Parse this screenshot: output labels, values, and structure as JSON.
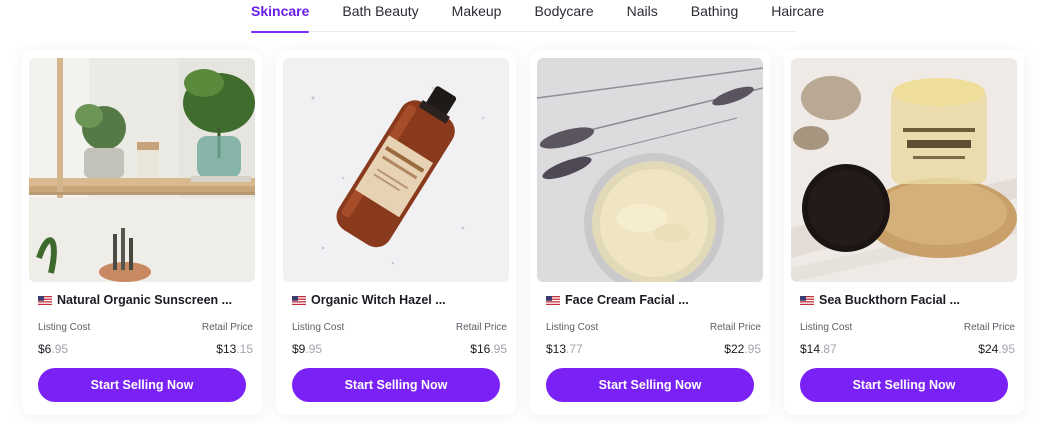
{
  "tabs": [
    {
      "label": "Skincare",
      "active": true
    },
    {
      "label": "Bath Beauty",
      "active": false
    },
    {
      "label": "Makeup",
      "active": false
    },
    {
      "label": "Bodycare",
      "active": false
    },
    {
      "label": "Nails",
      "active": false
    },
    {
      "label": "Bathing",
      "active": false
    },
    {
      "label": "Haircare",
      "active": false
    }
  ],
  "colors": {
    "accent": "#7a22f5",
    "active_tab": "#6a1fe8"
  },
  "cards": [
    {
      "title": "Natural Organic Sunscreen ...",
      "flag": "us-flag-icon",
      "image": "shelf-with-plants-and-sunscreen-image",
      "listing_label": "Listing Cost",
      "retail_label": "Retail Price",
      "listing_main": "$6",
      "listing_cents": ".95",
      "retail_main": "$13",
      "retail_cents": ".15",
      "button": "Start Selling Now"
    },
    {
      "title": "Organic Witch Hazel ...",
      "flag": "us-flag-icon",
      "image": "amber-bottle-witch-hazel-image",
      "listing_label": "Listing Cost",
      "retail_label": "Retail Price",
      "listing_main": "$9",
      "listing_cents": ".95",
      "retail_main": "$16",
      "retail_cents": ".95",
      "button": "Start Selling Now"
    },
    {
      "title": "Face Cream Facial ...",
      "flag": "us-flag-icon",
      "image": "face-cream-jar-with-lavender-image",
      "listing_label": "Listing Cost",
      "retail_label": "Retail Price",
      "listing_main": "$13",
      "listing_cents": ".77",
      "retail_main": "$22",
      "retail_cents": ".95",
      "button": "Start Selling Now"
    },
    {
      "title": "Sea Buckthorn Facial ...",
      "flag": "us-flag-icon",
      "image": "sea-buckthorn-jar-on-wood-image",
      "listing_label": "Listing Cost",
      "retail_label": "Retail Price",
      "listing_main": "$14",
      "listing_cents": ".87",
      "retail_main": "$24",
      "retail_cents": ".95",
      "button": "Start Selling Now"
    }
  ]
}
